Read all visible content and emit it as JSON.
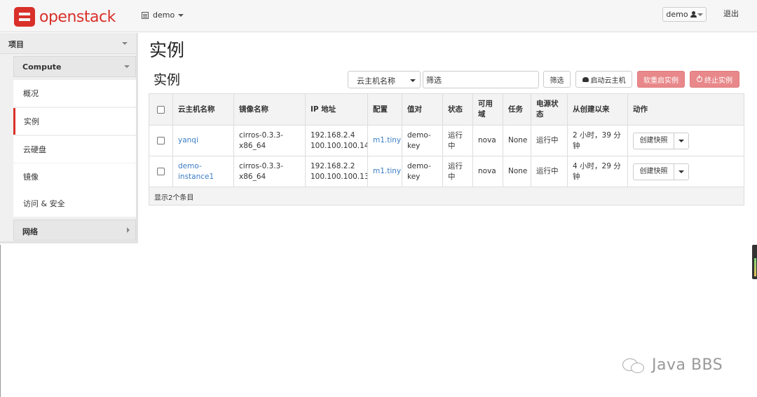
{
  "navbar": {
    "logo_text": "openstack",
    "project": "demo",
    "user": "demo",
    "logout": "退出"
  },
  "sidebar": {
    "section": "项目",
    "group": "Compute",
    "items": [
      {
        "label": "概况"
      },
      {
        "label": "实例",
        "active": true
      },
      {
        "label": "云硬盘"
      },
      {
        "label": "镜像"
      },
      {
        "label": "访问 & 安全"
      }
    ],
    "network": "网络"
  },
  "main": {
    "page_title": "实例",
    "section_title": "实例",
    "filter_field": "云主机名称",
    "filter_value": "筛选",
    "filter_button": "筛选",
    "launch_button": "启动云主机",
    "soft_reboot_button": "软重启实例",
    "terminate_button": "终止实例"
  },
  "table": {
    "headers": [
      "云主机名称",
      "镜像名称",
      "IP 地址",
      "配置",
      "值对",
      "状态",
      "可用域",
      "任务",
      "电源状态",
      "从创建以来",
      "动作"
    ],
    "rows": [
      {
        "name": "yanqi",
        "image": "cirros-0.3.3-x86_64",
        "ip": [
          "192.168.2.4",
          "100.100.100.14"
        ],
        "flavor": "m1.tiny",
        "keypair": "demo-key",
        "status": "运行中",
        "zone": "nova",
        "task": "None",
        "power": "运行中",
        "age": "2 小时，39 分钟",
        "action": "创建快照"
      },
      {
        "name": "demo-instance1",
        "image": "cirros-0.3.3-x86_64",
        "ip": [
          "192.168.2.2",
          "100.100.100.13"
        ],
        "flavor": "m1.tiny",
        "keypair": "demo-key",
        "status": "运行中",
        "zone": "nova",
        "task": "None",
        "power": "运行中",
        "age": "4 小时，29 分钟",
        "action": "创建快照"
      }
    ],
    "footer": "显示2个条目"
  },
  "watermark": "Java BBS",
  "colors": {
    "brand": "#d9302a",
    "danger_button": "#e8888a",
    "link": "#3b7dc4"
  }
}
